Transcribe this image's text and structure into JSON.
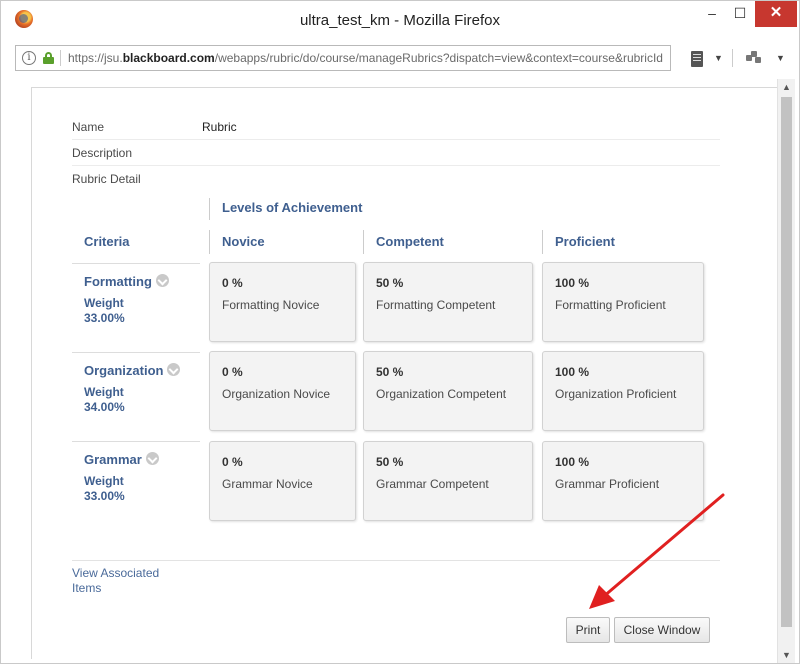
{
  "window": {
    "title": "ultra_test_km - Mozilla Firefox",
    "controls": {
      "minimize": "–",
      "maximize": "☐",
      "close": "✕"
    }
  },
  "addressbar": {
    "url_prefix": "https://jsu.",
    "url_domain": "blackboard.com",
    "url_suffix": "/webapps/rubric/do/course/manageRubrics?dispatch=view&context=course&rubricId"
  },
  "rubric": {
    "name_label": "Name",
    "name_value": "Rubric",
    "description_label": "Description",
    "detail_label": "Rubric Detail",
    "levels_header": "Levels of Achievement",
    "criteria_header": "Criteria",
    "columns": [
      "Novice",
      "Competent",
      "Proficient"
    ],
    "rows": [
      {
        "criterion": "Formatting",
        "weight_label": "Weight",
        "weight_value": "33.00%",
        "cells": [
          {
            "pct": "0 %",
            "desc": "Formatting Novice"
          },
          {
            "pct": "50 %",
            "desc": "Formatting Competent"
          },
          {
            "pct": "100 %",
            "desc": "Formatting Proficient"
          }
        ]
      },
      {
        "criterion": "Organization",
        "weight_label": "Weight",
        "weight_value": "34.00%",
        "cells": [
          {
            "pct": "0 %",
            "desc": "Organization Novice"
          },
          {
            "pct": "50 %",
            "desc": "Organization Competent"
          },
          {
            "pct": "100 %",
            "desc": "Organization Proficient"
          }
        ]
      },
      {
        "criterion": "Grammar",
        "weight_label": "Weight",
        "weight_value": "33.00%",
        "cells": [
          {
            "pct": "0 %",
            "desc": "Grammar Novice"
          },
          {
            "pct": "50 %",
            "desc": "Grammar Competent"
          },
          {
            "pct": "100 %",
            "desc": "Grammar Proficient"
          }
        ]
      }
    ],
    "view_associated_link": "View Associated Items"
  },
  "buttons": {
    "print": "Print",
    "close_window": "Close Window"
  },
  "colors": {
    "accent_text": "#3f5f8f",
    "link": "#4a6a9a",
    "close_button": "#c7372f",
    "annotation_arrow": "#e02020"
  }
}
